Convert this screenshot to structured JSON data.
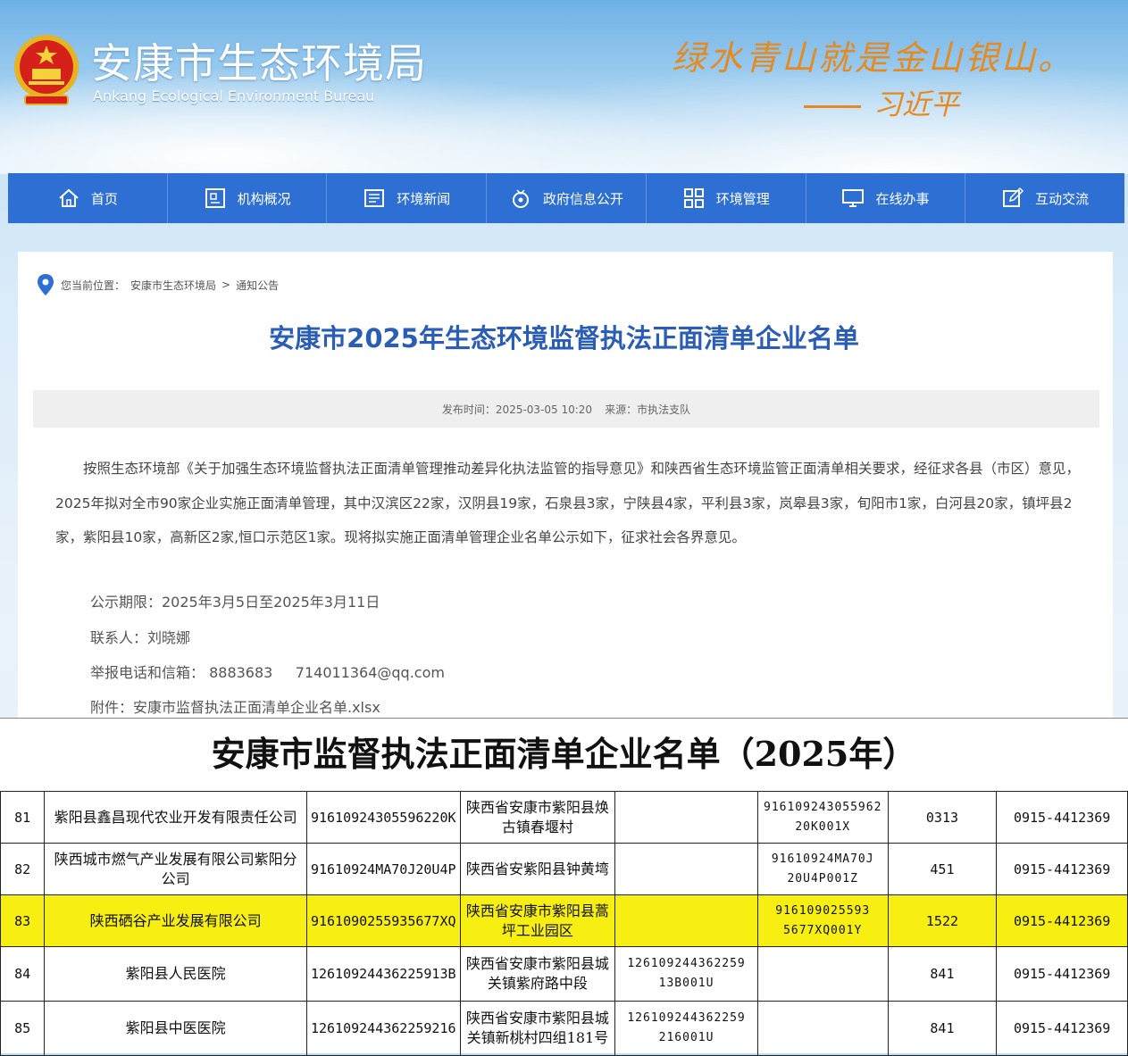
{
  "header": {
    "site_title": "安康市生态环境局",
    "site_subtitle": "Ankang Ecological Environment Bureau",
    "slogan": "绿水青山就是金山银山。",
    "slogan_author": "习近平"
  },
  "nav": [
    {
      "label": "首页",
      "icon": "home-icon"
    },
    {
      "label": "机构概况",
      "icon": "org-icon"
    },
    {
      "label": "环境新闻",
      "icon": "news-icon"
    },
    {
      "label": "政府信息公开",
      "icon": "info-icon"
    },
    {
      "label": "环境管理",
      "icon": "grid-icon"
    },
    {
      "label": "在线办事",
      "icon": "monitor-icon"
    },
    {
      "label": "互动交流",
      "icon": "edit-icon"
    }
  ],
  "breadcrumb": {
    "prefix": "您当前位置：",
    "items": [
      "安康市生态环境局",
      "通知公告"
    ],
    "separator": ">"
  },
  "article": {
    "title": "安康市2025年生态环境监督执法正面清单企业名单",
    "publish_time": "发布时间：2025-03-05 10:20",
    "source": "来源：市执法支队",
    "paragraph": "按照生态环境部《关于加强生态环境监督执法正面清单管理推动差异化执法监管的指导意见》和陕西省生态环境监管正面清单相关要求，经征求各县（市区）意见，2025年拟对全市90家企业实施正面清单管理，其中汉滨区22家，汉阴县19家，石泉县3家，宁陕县4家，平利县3家，岚皋县3家，旬阳市1家，白河县20家，镇坪县2家，紫阳县10家，高新区2家,恒口示范区1家。现将拟实施正面清单管理企业名单公示如下，征求社会各界意见。",
    "period": "公示期限：2025年3月5日至2025年3月11日",
    "contact": "联系人：刘晓娜",
    "report": "举报电话和信箱： 8883683     714011364@qq.com",
    "attachment": "附件：安康市监督执法正面清单企业名单.xlsx"
  },
  "sheet": {
    "title": "安康市监督执法正面清单企业名单（2025年）",
    "rows": [
      {
        "no": "81",
        "name": "紫阳县鑫昌现代农业开发有限责任公司",
        "credit": "91610924305596220K",
        "addr": "陕西省安康市紫阳县焕古镇春堰村",
        "code2": "",
        "permit": "916109243055962 20K001X",
        "num": "0313",
        "phone": "0915-4412369",
        "highlight": false
      },
      {
        "no": "82",
        "name": "陕西城市燃气产业发展有限公司紫阳分公司",
        "credit": "91610924MA70J20U4P",
        "addr": "陕西省安紫阳县钟黄塆",
        "code2": "",
        "permit": "91610924MA70J 20U4P001Z",
        "num": "451",
        "phone": "0915-4412369",
        "highlight": false
      },
      {
        "no": "83",
        "name": "陕西硒谷产业发展有限公司",
        "credit": "9161090255935677XQ",
        "addr": "陕西省安康市紫阳县蒿坪工业园区",
        "code2": "",
        "permit": "916109025593 5677XQ001Y",
        "num": "1522",
        "phone": "0915-4412369",
        "highlight": true
      },
      {
        "no": "84",
        "name": "紫阳县人民医院",
        "credit": "12610924436225913B",
        "addr": "陕西省安康市紫阳县城关镇紫府路中段",
        "code2": "126109244362259 13B001U",
        "permit": "",
        "num": "841",
        "phone": "0915-4412369",
        "highlight": false
      },
      {
        "no": "85",
        "name": "紫阳县中医医院",
        "credit": "126109244362259216",
        "addr": "陕西省安康市紫阳县城关镇新桃村四组181号",
        "code2": "126109244362259 216001U",
        "permit": "",
        "num": "841",
        "phone": "0915-4412369",
        "highlight": false
      }
    ]
  },
  "colors": {
    "nav_bg": "#2e6fd3",
    "title_blue": "#2a5db5",
    "slogan_orange": "#e68a1f",
    "row_highlight": "#f7ef12"
  }
}
